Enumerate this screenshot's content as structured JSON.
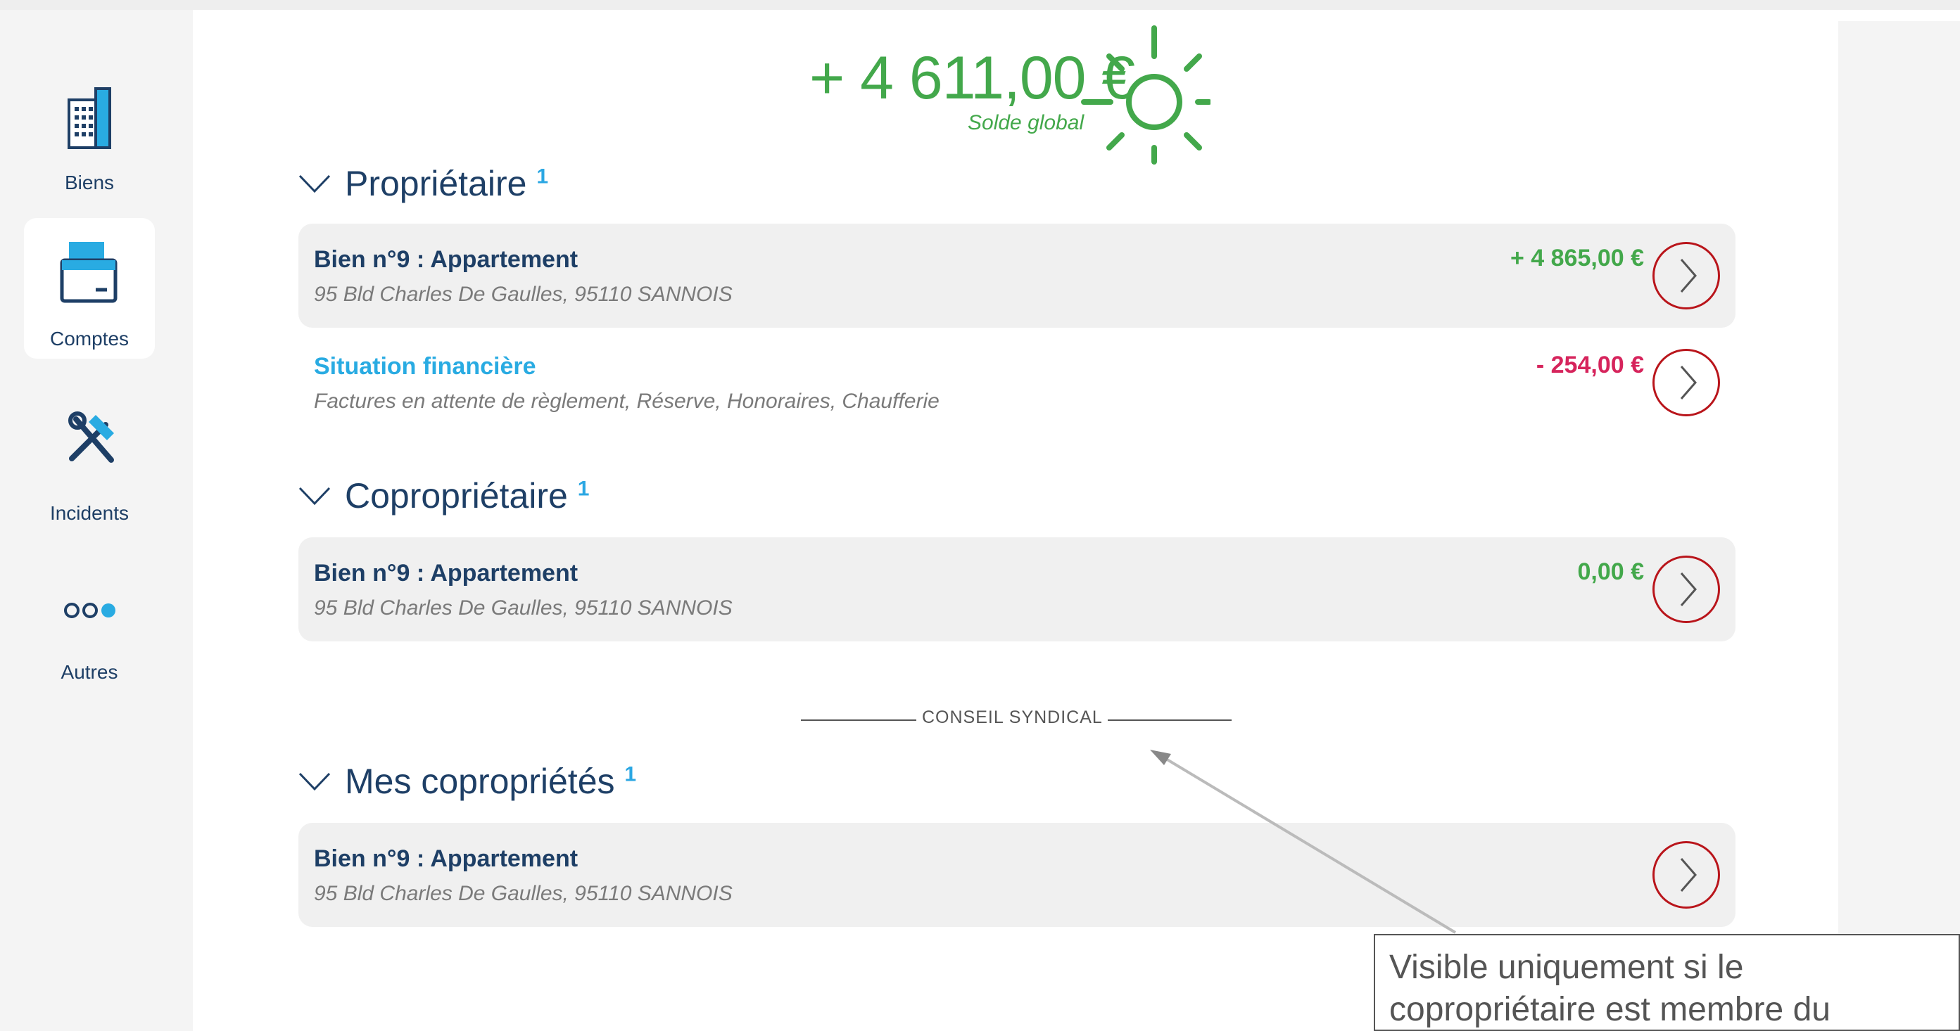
{
  "balance": {
    "amount": "+ 4 611,00 €",
    "label": "Solde global",
    "icon": "sun-icon",
    "color": "#43a84b"
  },
  "sidebar": {
    "items": [
      {
        "label": "Biens",
        "icon": "building-icon"
      },
      {
        "label": "Comptes",
        "icon": "wallet-icon",
        "active": true
      },
      {
        "label": "Incidents",
        "icon": "tools-icon"
      },
      {
        "label": "Autres",
        "icon": "more-dots-icon"
      }
    ]
  },
  "sections": [
    {
      "title": "Propriétaire",
      "count": "1",
      "rows": [
        {
          "title": "Bien n°9 : Appartement",
          "subtitle": "95 Bld Charles De Gaulles, 95110 SANNOIS",
          "amount": "+ 4 865,00 €",
          "status": "positive"
        },
        {
          "title": "Situation financière",
          "subtitle": "Factures en attente de règlement, Réserve, Honoraires, Chaufferie",
          "amount": "- 254,00 €",
          "status": "negative"
        }
      ]
    },
    {
      "title": "Copropriétaire",
      "count": "1",
      "rows": [
        {
          "title": "Bien n°9 : Appartement",
          "subtitle": "95 Bld Charles De Gaulles, 95110 SANNOIS",
          "amount": "0,00 €",
          "status": "positive"
        }
      ]
    },
    {
      "title": "Mes copropriétés",
      "count": "1",
      "rows": [
        {
          "title": "Bien n°9 : Appartement",
          "subtitle": "95 Bld Charles De Gaulles, 95110 SANNOIS",
          "amount": ""
        }
      ]
    }
  ],
  "divider": {
    "label": "CONSEIL SYNDICAL"
  },
  "annotation": {
    "text": "Visible uniquement si le copropriétaire est membre du"
  },
  "colors": {
    "accent": "#29abe2",
    "navy": "#1e3f66",
    "positive": "#43a84b",
    "negative": "#d6245c",
    "highlight_ring": "#b9151b"
  }
}
